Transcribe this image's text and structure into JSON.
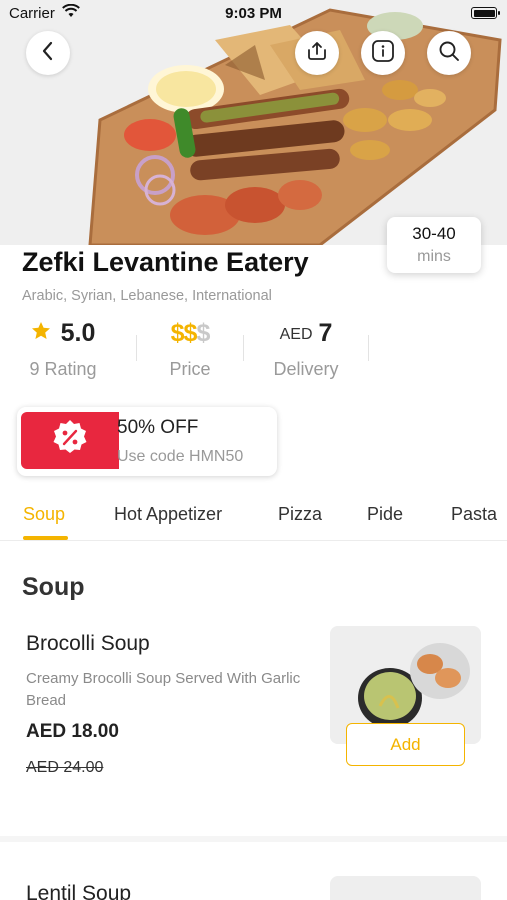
{
  "status_bar": {
    "carrier": "Carrier",
    "time": "9:03 PM"
  },
  "header": {
    "back_icon": "chevron-left-icon",
    "share_icon": "share-icon",
    "info_icon": "info-icon",
    "search_icon": "search-icon"
  },
  "delivery_time": {
    "value": "30-40",
    "unit": "mins"
  },
  "restaurant": {
    "name": "Zefki Levantine Eatery",
    "cuisines": "Arabic, Syrian, Lebanese, International"
  },
  "stats": {
    "rating": {
      "value": "5.0",
      "label": "9 Rating"
    },
    "price": {
      "active": "$$",
      "inactive": "$",
      "label": "Price"
    },
    "delivery": {
      "currency": "AED",
      "value": "7",
      "label": "Delivery"
    }
  },
  "promo": {
    "title": "50% OFF",
    "code_text": "Use code HMN50"
  },
  "tabs": [
    {
      "label": "Soup"
    },
    {
      "label": "Hot Appetizer"
    },
    {
      "label": "Pizza"
    },
    {
      "label": "Pide"
    },
    {
      "label": "Pasta"
    }
  ],
  "section_title": "Soup",
  "items": [
    {
      "name": "Brocolli Soup",
      "description": "Creamy Brocolli Soup Served With Garlic Bread",
      "price": "AED 18.00",
      "old_price": "AED 24.00",
      "add_label": "Add"
    },
    {
      "name": "Lentil Soup"
    }
  ],
  "colors": {
    "accent": "#f4b400",
    "promo_red": "#e8273f",
    "muted": "#999999"
  }
}
